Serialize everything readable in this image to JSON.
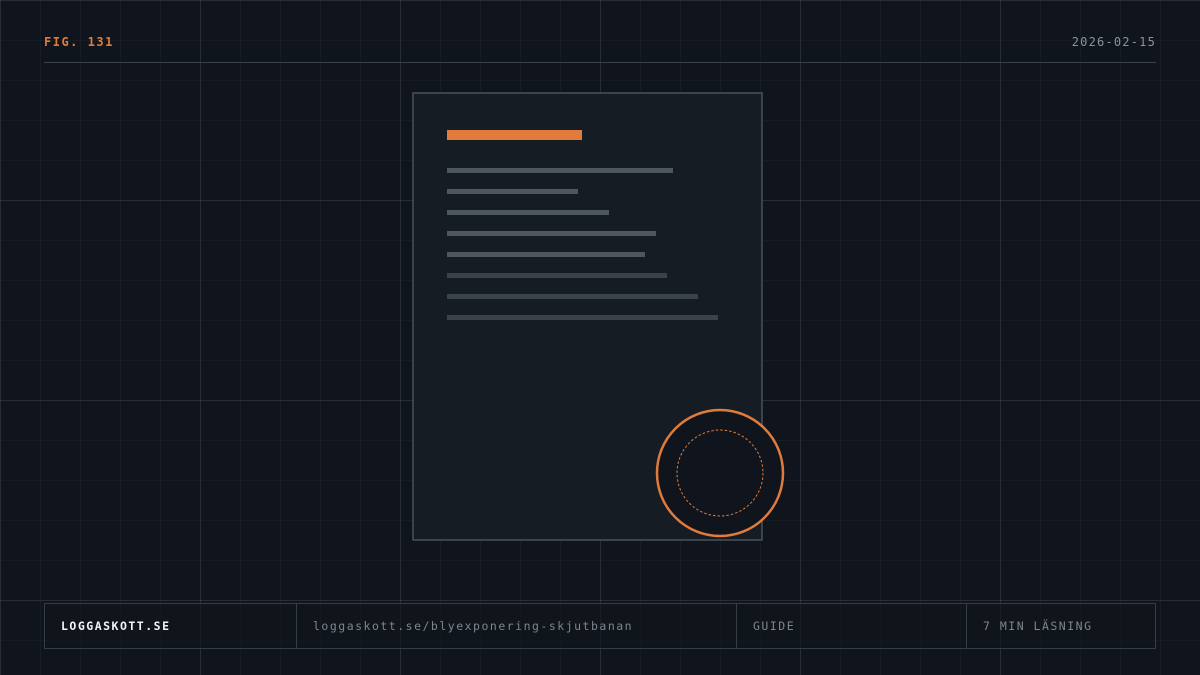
{
  "header": {
    "figure_label": "FIG. 131",
    "date": "2026-02-15"
  },
  "colors": {
    "accent": "#e07b3c",
    "background": "#10151d",
    "document_fill": "#161c24",
    "document_border": "#4a525c",
    "text_line": "#4e565f",
    "text_line_faint": "#3a424b"
  },
  "illustration": {
    "document_icon": "document-icon",
    "stamp_icon": "seal-stamp-icon"
  },
  "footer": {
    "brand": "LOGGASKOTT.SE",
    "url": "loggaskott.se/blyexponering-skjutbanan",
    "type": "GUIDE",
    "reading_time": "7 MIN LÄSNING"
  }
}
